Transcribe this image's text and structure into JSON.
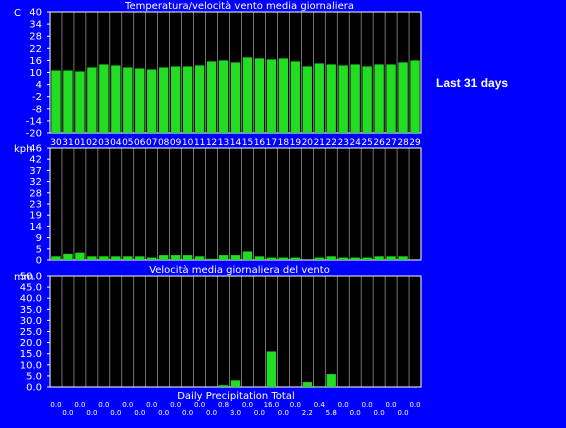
{
  "side_label": "Last 31 days",
  "colors": {
    "background": "#0000ff",
    "panel": "#000000",
    "bar": "#22dd22",
    "grid": "#ffffff",
    "text": "#ffffff"
  },
  "chart_data": [
    {
      "type": "bar",
      "title": "Temperatura/velocità vento media giornaliera",
      "unit": "C",
      "categories": [
        "30",
        "31",
        "01",
        "02",
        "03",
        "04",
        "05",
        "06",
        "07",
        "08",
        "09",
        "10",
        "11",
        "12",
        "13",
        "14",
        "15",
        "16",
        "17",
        "18",
        "19",
        "20",
        "21",
        "22",
        "23",
        "24",
        "25",
        "26",
        "27",
        "28",
        "29"
      ],
      "yticks": [
        "40",
        "34",
        "28",
        "22",
        "16",
        "10",
        "4",
        "-2",
        "-8",
        "-14",
        "-20"
      ],
      "ylim": [
        -20,
        40
      ],
      "values": [
        11,
        11,
        10.5,
        12.5,
        14,
        13.5,
        12.5,
        12,
        11.5,
        12.5,
        13,
        13,
        13.5,
        15.5,
        16,
        15,
        17.5,
        17,
        16.5,
        17,
        15.5,
        13,
        14.5,
        14,
        13.5,
        14,
        13,
        14,
        14,
        15,
        16
      ],
      "grid": "vertical"
    },
    {
      "type": "bar",
      "title": "",
      "unit": "kph",
      "yticks": [
        "46",
        "42",
        "37",
        "32",
        "28",
        "23",
        "19",
        "14",
        "9",
        "5",
        "0"
      ],
      "ylim": [
        0,
        46
      ],
      "values": [
        1.5,
        2.5,
        3,
        1.5,
        1.5,
        1.5,
        1.5,
        1.5,
        1,
        2,
        2,
        2,
        1.5,
        0.5,
        2,
        2,
        3.5,
        1.5,
        1,
        1,
        1,
        0,
        1,
        1.5,
        1,
        1,
        1,
        1.5,
        1.5,
        1.5,
        0
      ],
      "grid": "vertical"
    },
    {
      "type": "bar",
      "title": "Velocità media giornaliera del vento",
      "unit": "mm",
      "xlabel": "Daily Precipitation Total",
      "yticks": [
        "50.0",
        "45.0",
        "40.0",
        "35.0",
        "30.0",
        "25.0",
        "20.0",
        "15.0",
        "10.0",
        "5.0",
        "0.0"
      ],
      "ylim": [
        0,
        50
      ],
      "values": [
        0,
        0,
        0,
        0,
        0,
        0,
        0,
        0,
        0,
        0,
        0,
        0,
        0,
        0,
        0.8,
        3.0,
        0,
        0,
        16.0,
        0,
        0.0,
        2.2,
        0.4,
        5.8,
        0,
        0,
        0,
        0,
        0,
        0,
        0
      ],
      "value_labels": [
        "0.0",
        "0.0",
        "0.0",
        "0.0",
        "0.0",
        "0.0",
        "0.0",
        "0.0",
        "0.0",
        "0.0",
        "0.0",
        "0.0",
        "0.0",
        "0.0",
        "0.8",
        "3.0",
        "0.0",
        "0.0",
        "16.0",
        "0.0",
        "0.0",
        "2.2",
        "0.4",
        "5.8",
        "0.0",
        "0.0",
        "0.0",
        "0.0",
        "0.0",
        "0.0",
        "0.0"
      ],
      "grid": "vertical"
    }
  ]
}
